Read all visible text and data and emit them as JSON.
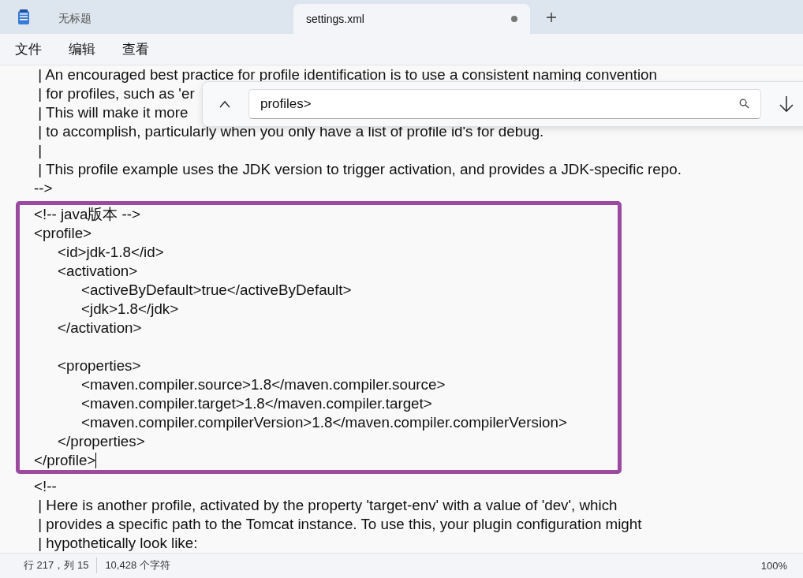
{
  "tabs": [
    {
      "label": "无标题",
      "selected": false,
      "modified": false
    },
    {
      "label": "settings.xml",
      "selected": true,
      "modified": true
    }
  ],
  "menu": [
    "文件",
    "编辑",
    "查看"
  ],
  "find": {
    "value": "profiles>"
  },
  "editor": {
    "before": [
      " | An encouraged best practice for profile identification is to use a consistent naming convention",
      " | for profiles, such as 'er",
      " | This will make it more",
      " | to accomplish, particularly when you only have a list of profile id's for debug.",
      " |",
      " | This profile example uses the JDK version to trigger activation, and provides a JDK-specific repo.",
      "-->"
    ],
    "highlighted": [
      {
        "text": "<!-- java版本 -->"
      },
      {
        "text": "<profile>"
      },
      {
        "text": "\t<id>jdk-1.8</id>"
      },
      {
        "text": "\t<activation>"
      },
      {
        "text": "\t\t<activeByDefault>true</activeByDefault>"
      },
      {
        "text": "\t\t<jdk>1.8</jdk>"
      },
      {
        "text": "\t</activation>"
      },
      {
        "kind": "blank"
      },
      {
        "text": "\t<properties>"
      },
      {
        "text": "\t\t<maven.compiler.source>1.8</maven.compiler.source>"
      },
      {
        "text": "\t\t<maven.compiler.target>1.8</maven.compiler.target>"
      },
      {
        "text": "\t\t<maven.compiler.compilerVersion>1.8</maven.compiler.compilerVersion>"
      },
      {
        "text": "\t</properties>"
      },
      {
        "text": "</profile>",
        "caret": true
      }
    ],
    "after": [
      "<!--",
      " | Here is another profile, activated by the property 'target-env' with a value of 'dev', which",
      " | provides a specific path to the Tomcat instance. To use this, your plugin configuration might",
      " | hypothetically look like:"
    ]
  },
  "status_bar": {
    "position": "行 217，列 15",
    "chars": "10,428 个字符",
    "zoom": "100%"
  }
}
